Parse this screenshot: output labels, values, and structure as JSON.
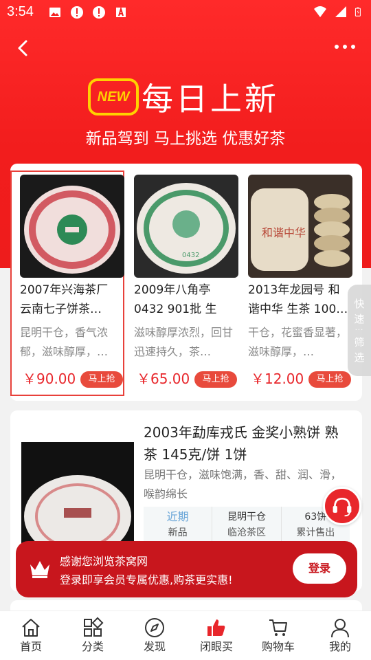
{
  "status_bar": {
    "time": "3:54"
  },
  "header": {
    "badge": "NEW",
    "title": "每日上新",
    "subtitle": "新品驾到 马上挑选 优惠好茶"
  },
  "products": [
    {
      "name": "2007年兴海茶厂 云南七子饼茶…",
      "desc": "昆明干仓，香气浓郁，滋味醇厚，…",
      "price": "￥90.00",
      "buy_label": "马上抢"
    },
    {
      "name": "2009年八角亭 0432 901批 生茶…",
      "desc": "滋味醇厚浓烈，回甘迅速持久，茶…",
      "price": "￥65.00",
      "buy_label": "马上抢"
    },
    {
      "name": "2013年龙园号 和谐中华 生茶 100…",
      "desc": "干仓，花蜜香显著，滋味醇厚，…",
      "price": "￥12.00",
      "buy_label": "马上抢"
    }
  ],
  "quick_filter": {
    "line1": "快",
    "line2": "速",
    "line3": "筛",
    "line4": "选"
  },
  "featured": {
    "title": "2003年勐库戎氏 金奖小熟饼 熟茶 145克/饼 1饼",
    "desc": "昆明干仓，滋味饱满，香、甜、润、滑，喉韵绵长",
    "stats": [
      {
        "top": "近期",
        "bottom": "新品"
      },
      {
        "top": "昆明干仓",
        "bottom": "临沧茶区"
      },
      {
        "top": "63饼",
        "bottom": "累计售出"
      }
    ]
  },
  "login_banner": {
    "line1": "感谢您浏览茶窝网",
    "line2": "登录即享会员专属优惠,购茶更实惠!",
    "button": "登录"
  },
  "bottom_nav": [
    {
      "label": "首页",
      "icon": "home-icon"
    },
    {
      "label": "分类",
      "icon": "grid-icon"
    },
    {
      "label": "发现",
      "icon": "compass-icon"
    },
    {
      "label": "闭眼买",
      "icon": "thumbs-up-icon"
    },
    {
      "label": "购物车",
      "icon": "cart-icon"
    },
    {
      "label": "我的",
      "icon": "user-icon"
    }
  ],
  "colors": {
    "brand_red": "#f21d1d",
    "price_red": "#e8262b",
    "badge_yellow": "#ffd200",
    "banner_red": "#c8161d"
  }
}
